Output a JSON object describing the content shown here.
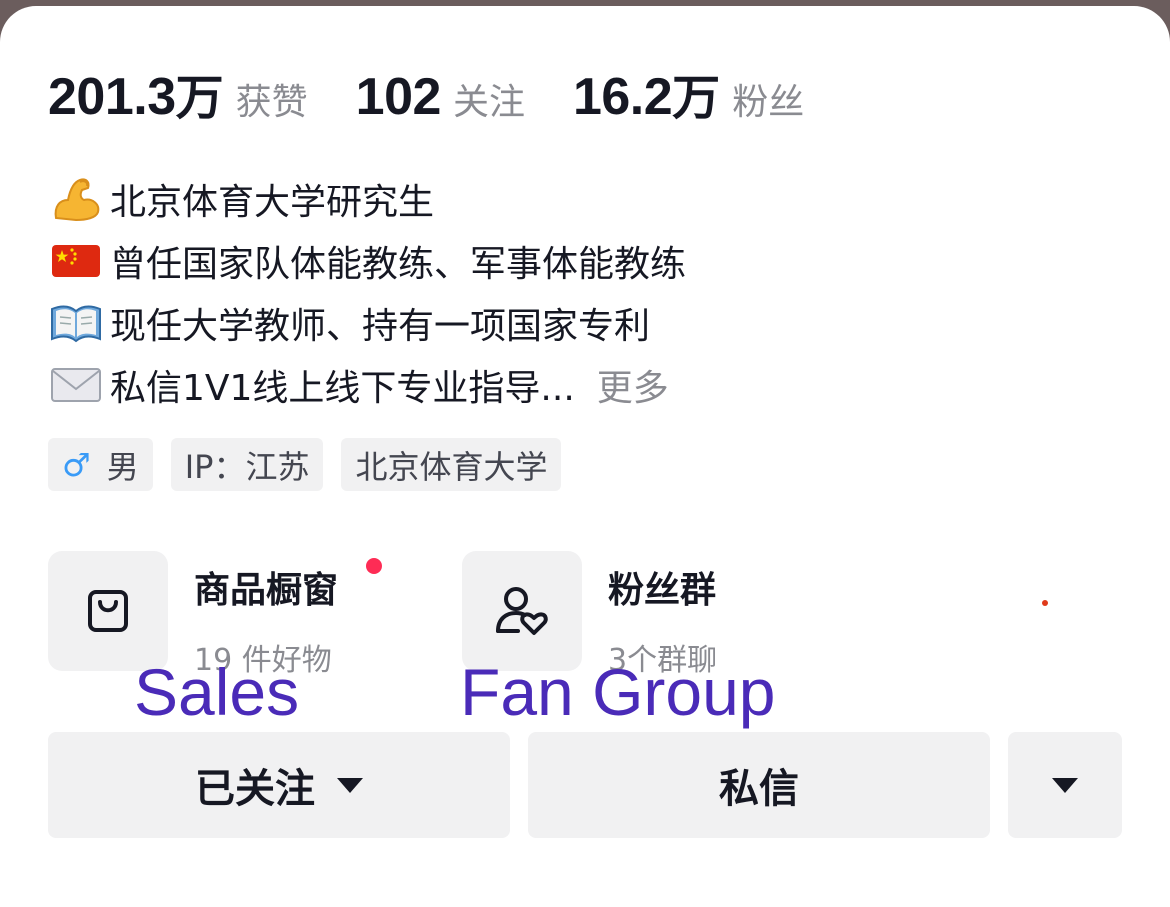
{
  "stats": [
    {
      "number": "201.3",
      "unit": "万",
      "label": "获赞"
    },
    {
      "number": "102",
      "unit": "",
      "label": "关注"
    },
    {
      "number": "16.2",
      "unit": "万",
      "label": "粉丝"
    }
  ],
  "bio": {
    "lines": [
      {
        "emoji": "💪",
        "icon": "flexed-biceps-icon",
        "text": "北京体育大学研究生"
      },
      {
        "emoji": "🇨🇳",
        "icon": "china-flag-icon",
        "text": "曾任国家队体能教练、军事体能教练"
      },
      {
        "emoji": "📖",
        "icon": "open-book-icon",
        "text": "现任大学教师、持有一项国家专利"
      },
      {
        "emoji": "✉️",
        "icon": "envelope-icon",
        "text": "私信1V1线上线下专业指导..."
      }
    ],
    "more_label": "更多"
  },
  "tags": {
    "gender_symbol": "♂",
    "gender": "男",
    "ip": "IP：江苏",
    "school": "北京体育大学"
  },
  "entries": {
    "shop": {
      "title": "商品橱窗",
      "subtitle": "19 件好物",
      "icon": "shopping-bag-icon"
    },
    "fan_group": {
      "title": "粉丝群",
      "subtitle": "3个群聊",
      "icon": "user-heart-icon"
    }
  },
  "annotations": {
    "sales": "Sales",
    "fan_group": "Fan Group"
  },
  "buttons": {
    "followed": "已关注",
    "message": "私信"
  },
  "colors": {
    "text_primary": "#161823",
    "text_secondary": "#8a8b91",
    "chip_bg": "#f1f1f2",
    "badge_red": "#fe2c55",
    "annotation_purple": "#4a2bb8",
    "male_blue": "#3a9bf7"
  }
}
